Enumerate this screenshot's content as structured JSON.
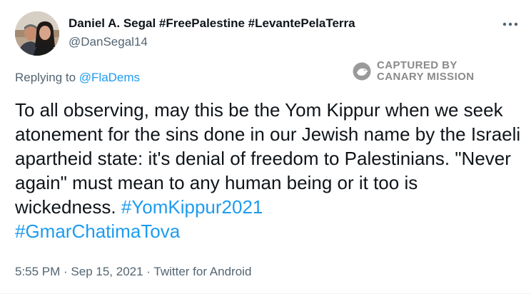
{
  "author": {
    "display_name": "Daniel A. Segal #FreePalestine #LevantePelaTerra",
    "handle": "@DanSegal14",
    "avatar_icon": "profile-photo-two-people"
  },
  "more_icon": "more-horizontal-icon",
  "reply_context": {
    "prefix": "Replying to ",
    "mention": "@FlaDems"
  },
  "watermark": {
    "line1": "CAPTURED BY",
    "line2": "CANARY MISSION",
    "icon": "canary-bird-icon"
  },
  "tweet": {
    "text": "To all observing, may this be the Yom Kippur when we seek atonement for the sins done in our Jewish name by the Israeli apartheid state: it's denial of freedom to Palestinians. \"Never again\" must mean to any human being or it too is wickedness. ",
    "hashtag1": "#YomKippur2021",
    "hashtag2": "#GmarChatimaTova"
  },
  "meta": {
    "time": "5:55 PM",
    "separator1": " · ",
    "date": "Sep 15, 2021",
    "separator2": " · ",
    "source": "Twitter for Android"
  },
  "colors": {
    "link": "#1d9bf0",
    "secondary_text": "#536471",
    "primary_text": "#0f1419",
    "watermark": "#8a8a8a"
  }
}
